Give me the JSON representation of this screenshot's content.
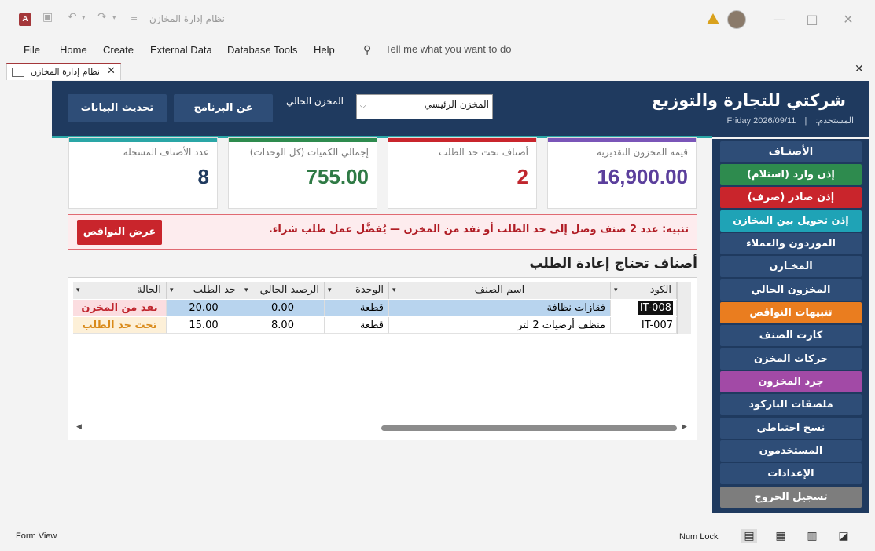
{
  "window": {
    "title": "نظام إدارة المخازن",
    "warning_icon": "warning-icon"
  },
  "ribbon": {
    "tabs": [
      "File",
      "Home",
      "Create",
      "External Data",
      "Database Tools",
      "Help"
    ],
    "tell_me": "Tell me what you want to do"
  },
  "doc_tab": {
    "label": "نظام إدارة المخازن"
  },
  "header": {
    "company": "شركتي للتجارة والتوزيع",
    "user_label": "المستخدم:",
    "date": "Friday  2026/09/11",
    "separator": "|",
    "refresh_button": "تحديث البيانات",
    "about_button": "عن البرنامج",
    "warehouse_label": "المخزن الحالي",
    "warehouse_value": "المخزن الرئيسي"
  },
  "cards": [
    {
      "label": "قيمة المخزون التقديرية",
      "value": "16,900.00",
      "color": "#5b3f9c",
      "bar": "#7a55b8"
    },
    {
      "label": "أصناف تحت حد الطلب",
      "value": "2",
      "color": "#c0262e",
      "bar": "#c9252c"
    },
    {
      "label": "إجمالي الكميات (كل الوحدات)",
      "value": "755.00",
      "color": "#2f7a45",
      "bar": "#2e8b4e"
    },
    {
      "label": "عدد الأصناف المسجلة",
      "value": "8",
      "color": "#1f3a5f",
      "bar": "#2aa6a6"
    }
  ],
  "alert": {
    "text": "تنبيه: عدد 2 صنف وصل إلى حد الطلب أو نفد من المخزن — يُفضَّل عمل طلب شراء.",
    "button": "عرض النواقص"
  },
  "reorder": {
    "title": "أصناف تحتاج إعادة الطلب",
    "columns": [
      "الكود",
      "اسم الصنف",
      "الوحدة",
      "الرصيد الحالي",
      "حد الطلب",
      "الحالة"
    ],
    "rows": [
      {
        "code": "IT-008",
        "name": "فقازات نظافة",
        "unit": "قطعة",
        "balance": "0.00",
        "reorder": "20.00",
        "status": "نفد من المخزن",
        "status_color": "#c0262e"
      },
      {
        "code": "IT-007",
        "name": "منظف أرضيات 2 لتر",
        "unit": "قطعة",
        "balance": "8.00",
        "reorder": "15.00",
        "status": "تحت حد الطلب",
        "status_color": "#d98a1a"
      }
    ]
  },
  "nav": [
    {
      "label": "الأصنـاف",
      "color": "#2e4d77"
    },
    {
      "label": "إذن وارد  (استلام)",
      "color": "#2e8b4e"
    },
    {
      "label": "إذن صادر  (صرف)",
      "color": "#c9252c"
    },
    {
      "label": "إذن تحويل بين المخازن",
      "color": "#1fa3b6"
    },
    {
      "label": "الموردون والعملاء",
      "color": "#2e4d77"
    },
    {
      "label": "المخـازن",
      "color": "#2e4d77"
    },
    {
      "label": "المخزون الحالي",
      "color": "#2e4d77"
    },
    {
      "label": "تنبيهات النواقص",
      "color": "#ea7d1f"
    },
    {
      "label": "كارت الصنف",
      "color": "#2e4d77"
    },
    {
      "label": "حركات المخزن",
      "color": "#2e4d77"
    },
    {
      "label": "جرد المخزون",
      "color": "#a24aa6"
    },
    {
      "label": "ملصقات الباركود",
      "color": "#2e4d77"
    },
    {
      "label": "نسخ احتياطي",
      "color": "#2e4d77"
    },
    {
      "label": "المستخدمون",
      "color": "#2e4d77"
    },
    {
      "label": "الإعدادات",
      "color": "#2e4d77"
    },
    {
      "label": "تسجيل الخروج",
      "color": "#7d7d7d"
    }
  ],
  "status": {
    "left": "Form View",
    "num_lock": "Num Lock"
  }
}
